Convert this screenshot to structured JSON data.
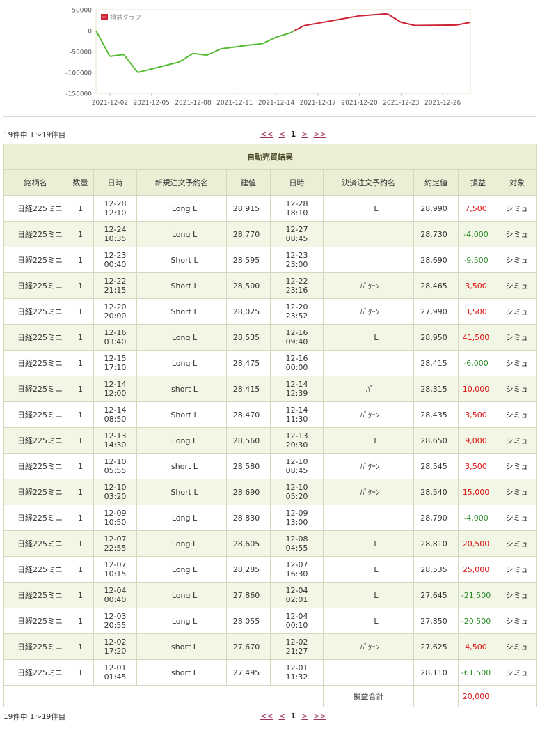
{
  "chart": {
    "legend": "損益グラフ",
    "y_ticks": [
      "50000",
      "0",
      "-50000",
      "-100000",
      "-150000"
    ],
    "x_ticks": [
      "2021-12-02",
      "2021-12-05",
      "2021-12-08",
      "2021-12-11",
      "2021-12-14",
      "2021-12-17",
      "2021-12-20",
      "2021-12-23",
      "2021-12-26"
    ],
    "colors": {
      "gain": "#cc2233",
      "loss_side": "#55bb33",
      "frame": "#e1e4c8"
    }
  },
  "chart_data": {
    "type": "line",
    "x": [
      "2021-12-01",
      "2021-12-02",
      "2021-12-03",
      "2021-12-04",
      "2021-12-07",
      "2021-12-08",
      "2021-12-09",
      "2021-12-10",
      "2021-12-12",
      "2021-12-13",
      "2021-12-14",
      "2021-12-15",
      "2021-12-16",
      "2021-12-20",
      "2021-12-22",
      "2021-12-23",
      "2021-12-24",
      "2021-12-27",
      "2021-12-28"
    ],
    "values": [
      0,
      -61500,
      -57000,
      -100000,
      -75000,
      -54500,
      -58500,
      -43500,
      -34500,
      -31000,
      -15500,
      -5500,
      12000,
      35500,
      40500,
      20000,
      12500,
      13500,
      20000
    ],
    "ylim": [
      -150000,
      50000
    ],
    "grid": false,
    "legend": "top-left",
    "series_name": "損益グラフ"
  },
  "pagination": {
    "count_text": "19件中 1～19件目",
    "first": "<<",
    "prev": "<",
    "current": "1",
    "next": ">",
    "last": ">>"
  },
  "table": {
    "title": "自動売買結果",
    "headers": [
      "銘柄名",
      "数量",
      "日時",
      "新規注文予約名",
      "建値",
      "日時",
      "決済注文予約名",
      "約定値",
      "損益",
      "対象"
    ],
    "rows": [
      {
        "name": "日経225ミニ",
        "qty": "1",
        "entry_date": "12-28",
        "entry_time": "12:10",
        "entry_order": "Long L",
        "entry_price": "28,915",
        "exit_date": "12-28",
        "exit_time": "18:10",
        "exit_order": "L",
        "exit_price": "28,990",
        "pl": "7,500",
        "target": "シミュ"
      },
      {
        "name": "日経225ミニ",
        "qty": "1",
        "entry_date": "12-24",
        "entry_time": "10:35",
        "entry_order": "Long L",
        "entry_price": "28,770",
        "exit_date": "12-27",
        "exit_time": "08:45",
        "exit_order": "",
        "exit_price": "28,730",
        "pl": "-4,000",
        "target": "シミュ"
      },
      {
        "name": "日経225ミニ",
        "qty": "1",
        "entry_date": "12-23",
        "entry_time": "00:40",
        "entry_order": "Short L",
        "entry_price": "28,595",
        "exit_date": "12-23",
        "exit_time": "23:00",
        "exit_order": "",
        "exit_price": "28,690",
        "pl": "-9,500",
        "target": "シミュ"
      },
      {
        "name": "日経225ミニ",
        "qty": "1",
        "entry_date": "12-22",
        "entry_time": "21:15",
        "entry_order": "Short L",
        "entry_price": "28,500",
        "exit_date": "12-22",
        "exit_time": "23:16",
        "exit_order": "ﾊﾟﾀｰﾝ",
        "exit_price": "28,465",
        "pl": "3,500",
        "target": "シミュ"
      },
      {
        "name": "日経225ミニ",
        "qty": "1",
        "entry_date": "12-20",
        "entry_time": "20:00",
        "entry_order": "Short L",
        "entry_price": "28,025",
        "exit_date": "12-20",
        "exit_time": "23:52",
        "exit_order": "ﾊﾟﾀｰﾝ",
        "exit_price": "27,990",
        "pl": "3,500",
        "target": "シミュ"
      },
      {
        "name": "日経225ミニ",
        "qty": "1",
        "entry_date": "12-16",
        "entry_time": "03:40",
        "entry_order": "Long L",
        "entry_price": "28,535",
        "exit_date": "12-16",
        "exit_time": "09:40",
        "exit_order": "L",
        "exit_price": "28,950",
        "pl": "41,500",
        "target": "シミュ"
      },
      {
        "name": "日経225ミニ",
        "qty": "1",
        "entry_date": "12-15",
        "entry_time": "17:10",
        "entry_order": "Long L",
        "entry_price": "28,475",
        "exit_date": "12-16",
        "exit_time": "00:00",
        "exit_order": "",
        "exit_price": "28,415",
        "pl": "-6,000",
        "target": "シミュ"
      },
      {
        "name": "日経225ミニ",
        "qty": "1",
        "entry_date": "12-14",
        "entry_time": "12:00",
        "entry_order": "short L",
        "entry_price": "28,415",
        "exit_date": "12-14",
        "exit_time": "12:39",
        "exit_order": "ﾊﾟ",
        "exit_price": "28,315",
        "pl": "10,000",
        "target": "シミュ"
      },
      {
        "name": "日経225ミニ",
        "qty": "1",
        "entry_date": "12-14",
        "entry_time": "08:50",
        "entry_order": "Short L",
        "entry_price": "28,470",
        "exit_date": "12-14",
        "exit_time": "11:30",
        "exit_order": "ﾊﾟﾀｰﾝ",
        "exit_price": "28,435",
        "pl": "3,500",
        "target": "シミュ"
      },
      {
        "name": "日経225ミニ",
        "qty": "1",
        "entry_date": "12-13",
        "entry_time": "14:30",
        "entry_order": "Long L",
        "entry_price": "28,560",
        "exit_date": "12-13",
        "exit_time": "20:30",
        "exit_order": "L",
        "exit_price": "28,650",
        "pl": "9,000",
        "target": "シミュ"
      },
      {
        "name": "日経225ミニ",
        "qty": "1",
        "entry_date": "12-10",
        "entry_time": "05:55",
        "entry_order": "short L",
        "entry_price": "28,580",
        "exit_date": "12-10",
        "exit_time": "08:45",
        "exit_order": "ﾊﾟﾀｰﾝ",
        "exit_price": "28,545",
        "pl": "3,500",
        "target": "シミュ"
      },
      {
        "name": "日経225ミニ",
        "qty": "1",
        "entry_date": "12-10",
        "entry_time": "03:20",
        "entry_order": "Short L",
        "entry_price": "28,690",
        "exit_date": "12-10",
        "exit_time": "05:20",
        "exit_order": "ﾊﾟﾀｰﾝ",
        "exit_price": "28,540",
        "pl": "15,000",
        "target": "シミュ"
      },
      {
        "name": "日経225ミニ",
        "qty": "1",
        "entry_date": "12-09",
        "entry_time": "10:50",
        "entry_order": "Long L",
        "entry_price": "28,830",
        "exit_date": "12-09",
        "exit_time": "13:00",
        "exit_order": "",
        "exit_price": "28,790",
        "pl": "-4,000",
        "target": "シミュ"
      },
      {
        "name": "日経225ミニ",
        "qty": "1",
        "entry_date": "12-07",
        "entry_time": "22:55",
        "entry_order": "Long L",
        "entry_price": "28,605",
        "exit_date": "12-08",
        "exit_time": "04:55",
        "exit_order": "L",
        "exit_price": "28,810",
        "pl": "20,500",
        "target": "シミュ"
      },
      {
        "name": "日経225ミニ",
        "qty": "1",
        "entry_date": "12-07",
        "entry_time": "10:15",
        "entry_order": "Long L",
        "entry_price": "28,285",
        "exit_date": "12-07",
        "exit_time": "16:30",
        "exit_order": "L",
        "exit_price": "28,535",
        "pl": "25,000",
        "target": "シミュ"
      },
      {
        "name": "日経225ミニ",
        "qty": "1",
        "entry_date": "12-04",
        "entry_time": "00:40",
        "entry_order": "Long L",
        "entry_price": "27,860",
        "exit_date": "12-04",
        "exit_time": "02:01",
        "exit_order": "L",
        "exit_price": "27,645",
        "pl": "-21,500",
        "target": "シミュ"
      },
      {
        "name": "日経225ミニ",
        "qty": "1",
        "entry_date": "12-03",
        "entry_time": "20:55",
        "entry_order": "Long L",
        "entry_price": "28,055",
        "exit_date": "12-04",
        "exit_time": "00:10",
        "exit_order": "L",
        "exit_price": "27,850",
        "pl": "-20,500",
        "target": "シミュ"
      },
      {
        "name": "日経225ミニ",
        "qty": "1",
        "entry_date": "12-02",
        "entry_time": "17:20",
        "entry_order": "short L",
        "entry_price": "27,670",
        "exit_date": "12-02",
        "exit_time": "21:27",
        "exit_order": "ﾊﾟﾀｰﾝ",
        "exit_price": "27,625",
        "pl": "4,500",
        "target": "シミュ"
      },
      {
        "name": "日経225ミニ",
        "qty": "1",
        "entry_date": "12-01",
        "entry_time": "01:45",
        "entry_order": "short L",
        "entry_price": "27,495",
        "exit_date": "12-01",
        "exit_time": "11:32",
        "exit_order": "",
        "exit_price": "28,110",
        "pl": "-61,500",
        "target": "シミュ"
      }
    ],
    "total_label": "損益合計",
    "total_value": "20,000"
  }
}
